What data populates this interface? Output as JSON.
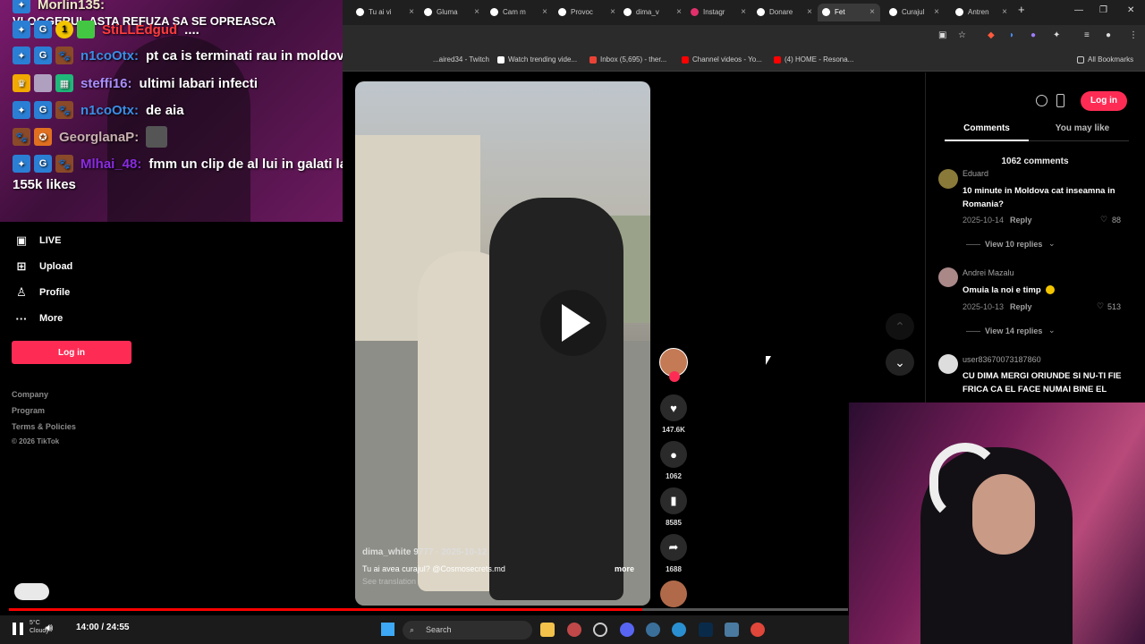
{
  "chat": {
    "lines": [
      {
        "user": "Morlin135:",
        "text": "",
        "color": "#f0e9c8"
      },
      {
        "user": "",
        "text": "VLOGGERUL ASTA REFUZA SA SE OPREASCA",
        "color": "#ffffff"
      },
      {
        "user": "StiLLEdgud",
        "text": "....",
        "color": "#ff3b3b"
      },
      {
        "user": "n1coOtx:",
        "text": "pt ca is terminati rau in moldova coaie",
        "color": "#3a8ee6"
      },
      {
        "user": "steffi16:",
        "text": "ultimi labari infecti",
        "color": "#a98fff"
      },
      {
        "user": "n1coOtx:",
        "text": "de aia",
        "color": "#3a8ee6"
      },
      {
        "user": "GeorglanaP:",
        "text": "",
        "color": "#c8b0b0"
      },
      {
        "user": "Mlhai_48:",
        "text": "fmm un clip de al lui in galati la mn in",
        "color": "#8a2be2"
      }
    ],
    "likes": "155k likes"
  },
  "browser": {
    "tabs": [
      "Tu ai vi",
      "Gluma",
      "Cam m",
      "Provoc",
      "dima_v",
      "Instagr",
      "Donare",
      "Fet",
      "Curajul",
      "Antren"
    ],
    "bookmarks": [
      "...aired34 - Twitch",
      "Watch trending vide...",
      "Inbox (5,695) - ther...",
      "Channel videos - Yo...",
      "(4) HOME - Resona..."
    ],
    "all_bookmarks": "All Bookmarks"
  },
  "nav": {
    "items": [
      {
        "label": "LIVE",
        "icon": "live-icon"
      },
      {
        "label": "Upload",
        "icon": "upload-icon"
      },
      {
        "label": "Profile",
        "icon": "profile-icon"
      },
      {
        "label": "More",
        "icon": "more-icon"
      }
    ],
    "login": "Log in",
    "footer": [
      "Company",
      "Program",
      "Terms & Policies",
      "© 2026 TikTok"
    ]
  },
  "video": {
    "author": "dima_white 9777",
    "date": "2025-10-12",
    "caption": "Tu ai avea curajul? @Cosmosecrets.md",
    "more": "more",
    "see_translation": "See translation",
    "likes": "147.6K",
    "comments": "1062",
    "saves": "8585",
    "shares": "1688"
  },
  "panel": {
    "login": "Log in",
    "tab_comments": "Comments",
    "tab_you_may_like": "You may like",
    "count": "1062 comments",
    "comments": [
      {
        "user": "Eduard",
        "text": "10 minute in Moldova cat inseamna in Romania?",
        "date": "2025-10-14",
        "reply": "Reply",
        "likes": "88",
        "view_replies": "View 10 replies"
      },
      {
        "user": "Andrei Mazalu",
        "text": "Omuia la noi e timp",
        "date": "2025-10-13",
        "reply": "Reply",
        "likes": "513",
        "view_replies": "View 14 replies"
      },
      {
        "user": "user83670073187860",
        "text": "CU DIMA MERGI ORIUNDE SI NU-TI FIE FRICA CA EL FACE NUMAI BINE EL",
        "date": "",
        "reply": "",
        "likes": "",
        "view_replies": ""
      }
    ]
  },
  "player": {
    "time": "14:00 / 24:55",
    "progress": 0.755
  },
  "taskbar": {
    "weather_temp": "5°C",
    "weather_desc": "Cloudy",
    "search": "Search"
  }
}
